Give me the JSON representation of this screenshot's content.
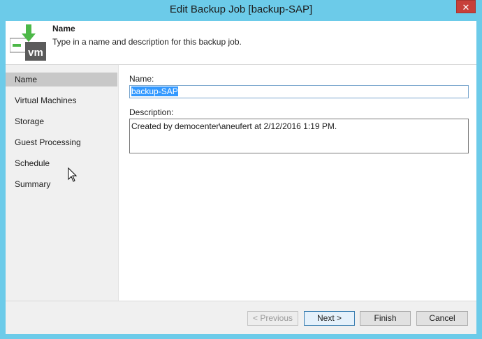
{
  "window": {
    "title": "Edit Backup Job [backup-SAP]",
    "close_label": "✕"
  },
  "header": {
    "title": "Name",
    "description": "Type in a name and description for this backup job.",
    "logo_text": "vm",
    "logo_icon": "vm-backup-logo-icon"
  },
  "nav": {
    "items": [
      {
        "label": "Name",
        "active": true
      },
      {
        "label": "Virtual Machines"
      },
      {
        "label": "Storage"
      },
      {
        "label": "Guest Processing"
      },
      {
        "label": "Schedule"
      },
      {
        "label": "Summary"
      }
    ]
  },
  "form": {
    "name_label": "Name:",
    "name_value": "backup-SAP",
    "description_label": "Description:",
    "description_value": "Created by democenter\\aneufert at 2/12/2016 1:19 PM."
  },
  "buttons": {
    "previous": "< Previous",
    "next": "Next >",
    "finish": "Finish",
    "cancel": "Cancel"
  },
  "colors": {
    "window_frame": "#6ccbe9",
    "close_button": "#c7403a",
    "selection": "#3399ff",
    "logo_green": "#4db848"
  }
}
